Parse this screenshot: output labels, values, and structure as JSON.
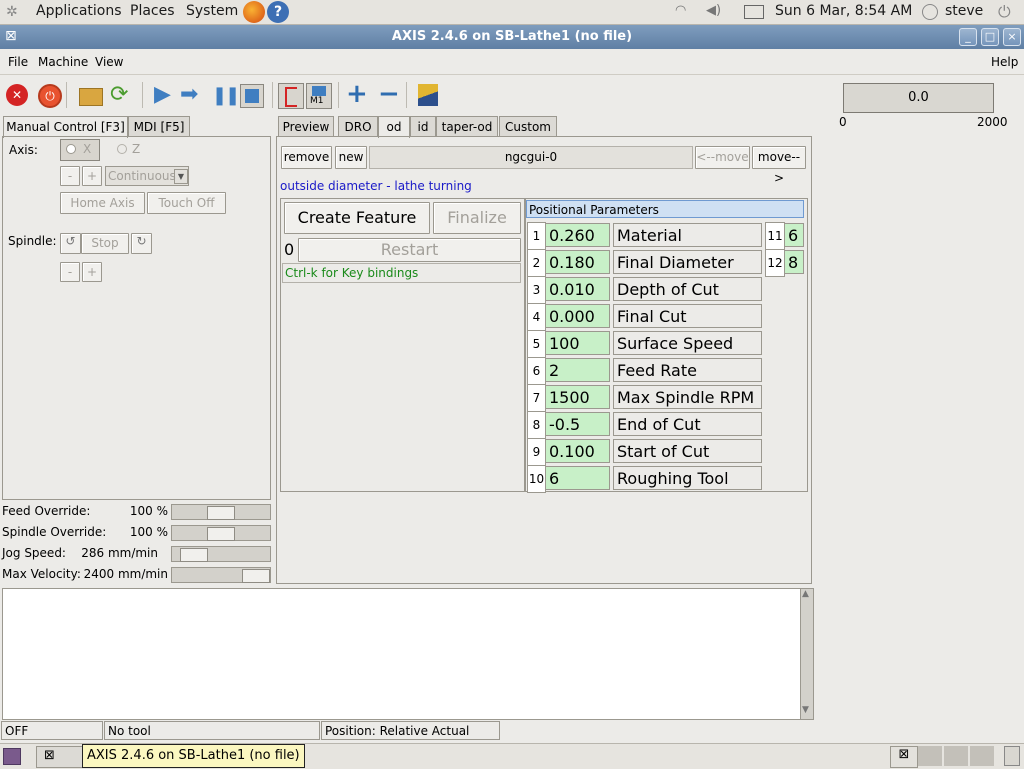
{
  "top_panel": {
    "menus": [
      "Applications",
      "Places",
      "System"
    ],
    "clock": "Sun  6 Mar,  8:54 AM",
    "user": "steve"
  },
  "window": {
    "title": "AXIS 2.4.6 on SB-Lathe1 (no file)"
  },
  "menubar": {
    "items": [
      "File",
      "Machine",
      "View"
    ],
    "help": "Help"
  },
  "toolbar": {
    "toggle_label": "M1"
  },
  "gauge": {
    "value": "0.0",
    "min_label": "0",
    "max_label": "2000"
  },
  "left_tabs": [
    "Manual Control [F3]",
    "MDI [F5]"
  ],
  "manual": {
    "axis_label": "Axis:",
    "axis_x": "X",
    "axis_z": "Z",
    "minus": "-",
    "plus": "+",
    "jog_mode": "Continuous",
    "home_axis": "Home Axis",
    "touch_off": "Touch Off",
    "spindle_label": "Spindle:",
    "stop": "Stop"
  },
  "overrides": [
    {
      "label": "Feed Override:",
      "value": "100 %",
      "level": 0.5
    },
    {
      "label": "Spindle Override:",
      "value": "100 %",
      "level": 0.5
    },
    {
      "label": "Jog Speed:",
      "value": "286 mm/min",
      "level": 0.12
    },
    {
      "label": "Max Velocity:",
      "value": "2400 mm/min",
      "level": 1.0
    }
  ],
  "right_tabs": [
    "Preview",
    "DRO",
    "od",
    "id",
    "taper-od",
    "Custom"
  ],
  "ngcgui": {
    "remove": "remove",
    "new": "new",
    "name": "ngcgui-0",
    "move_left": "<--move",
    "move_right": "move-->",
    "description": "outside diameter - lathe turning",
    "create_feature": "Create Feature",
    "finalize": "Finalize",
    "count": "0",
    "restart": "Restart",
    "key_hint": "Ctrl-k for Key bindings",
    "params_title": "Positional Parameters",
    "params": [
      {
        "num": "1",
        "value": "0.260",
        "label": "Material Diameter"
      },
      {
        "num": "2",
        "value": "0.180",
        "label": "Final Diameter"
      },
      {
        "num": "3",
        "value": "0.010",
        "label": "Depth of Cut"
      },
      {
        "num": "4",
        "value": "0.000",
        "label": "Final Cut"
      },
      {
        "num": "5",
        "value": "100",
        "label": "Surface Speed"
      },
      {
        "num": "6",
        "value": "2",
        "label": "Feed Rate"
      },
      {
        "num": "7",
        "value": "1500",
        "label": "Max Spindle RPM"
      },
      {
        "num": "8",
        "value": "-0.5",
        "label": "End of Cut"
      },
      {
        "num": "9",
        "value": "0.100",
        "label": "Start of Cut"
      },
      {
        "num": "10",
        "value": "6",
        "label": "Roughing Tool"
      }
    ],
    "extra_params": [
      {
        "num": "11",
        "value": "6"
      },
      {
        "num": "12",
        "value": "8"
      }
    ]
  },
  "status": {
    "state": "OFF",
    "tool": "No tool",
    "position": "Position: Relative Actual"
  },
  "taskbar": {
    "tooltip": "AXIS 2.4.6 on SB-Lathe1 (no file)"
  }
}
